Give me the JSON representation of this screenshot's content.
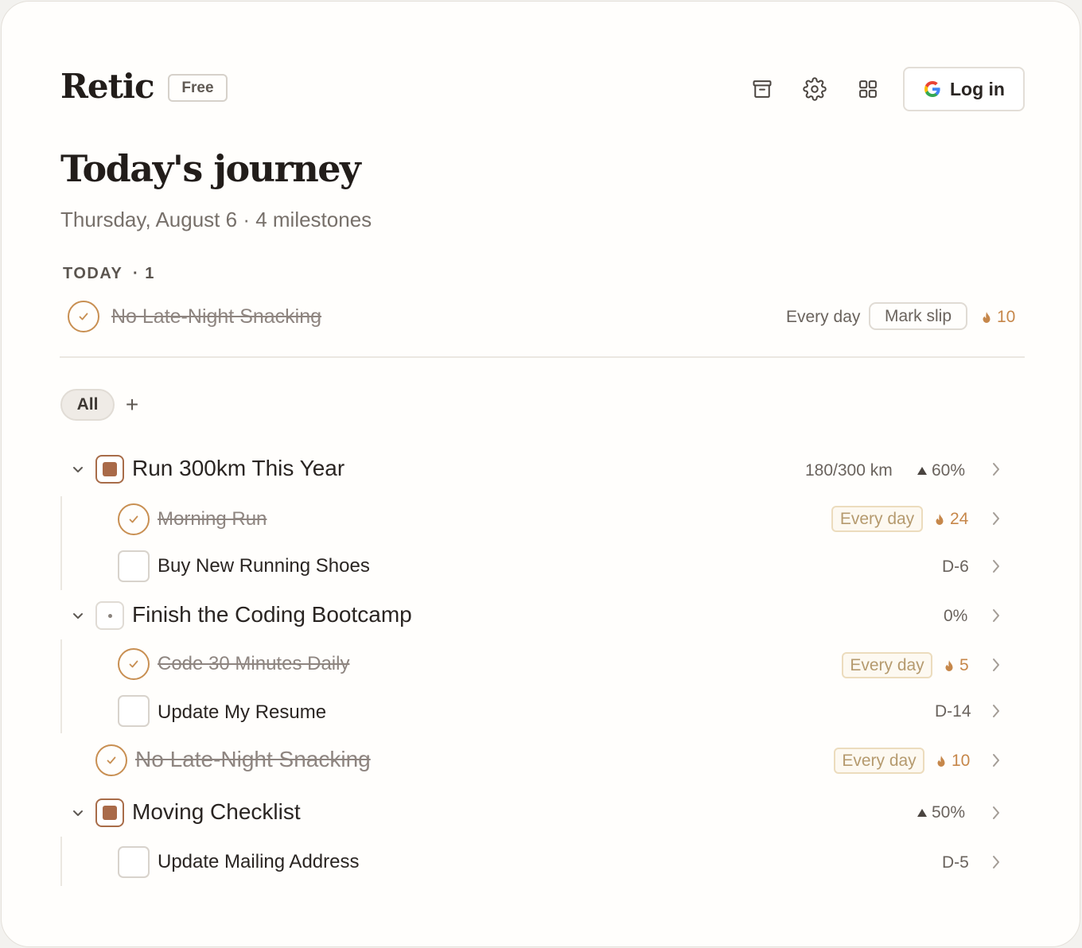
{
  "header": {
    "brand": "Retic",
    "plan_badge": "Free",
    "login_label": "Log in",
    "icons": [
      "archive-icon",
      "gear-icon",
      "grid-icon",
      "google-icon"
    ]
  },
  "page": {
    "title": "Today's journey",
    "subtitle": "Thursday, August 6 · 4 milestones"
  },
  "today": {
    "label": "TODAY",
    "count": "· 1",
    "item": {
      "title": "No Late-Night Snacking",
      "frequency": "Every day",
      "action": "Mark slip",
      "streak": "10"
    }
  },
  "filters": {
    "all_label": "All",
    "add_label": "+"
  },
  "goals": [
    {
      "title": "Run 300km This Year",
      "progress_text": "180/300 km",
      "percent": "60%",
      "tasks": [
        {
          "title": "Morning Run",
          "frequency": "Every day",
          "streak": "24"
        },
        {
          "title": "Buy New Running Shoes",
          "due": "D-6"
        }
      ]
    },
    {
      "title": "Finish the Coding Bootcamp",
      "percent": "0%",
      "tasks": [
        {
          "title": "Code 30 Minutes Daily",
          "frequency": "Every day",
          "streak": "5"
        },
        {
          "title": "Update My Resume",
          "due": "D-14"
        }
      ]
    },
    {
      "title": "Moving Checklist",
      "percent": "50%",
      "tasks": [
        {
          "title": "Update Mailing Address",
          "due": "D-5"
        }
      ]
    }
  ],
  "standalone": {
    "title": "No Late-Night Snacking",
    "frequency": "Every day",
    "streak": "10"
  },
  "colors": {
    "accent": "#c88f52",
    "goal": "#a96a49",
    "streak": "#c6874a"
  }
}
